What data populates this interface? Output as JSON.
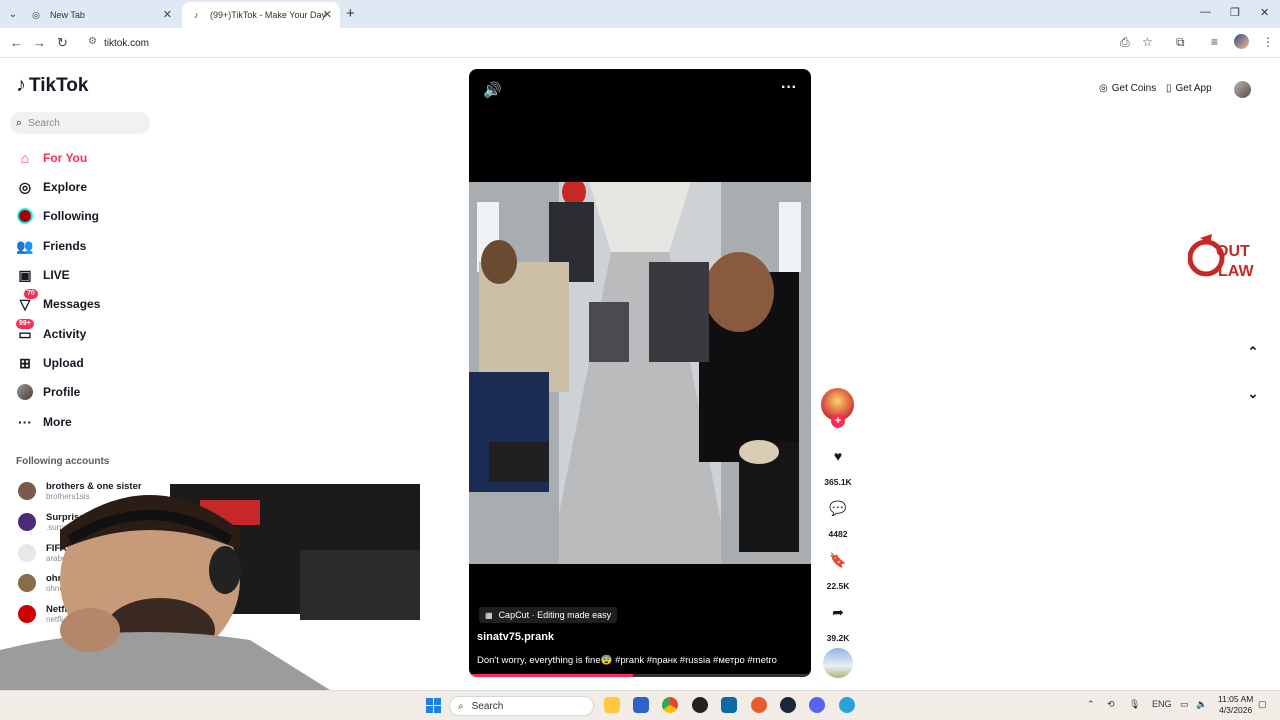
{
  "browser": {
    "tabs": [
      {
        "title": "New Tab",
        "active": false
      },
      {
        "title": "(99+)TikTok - Make Your Day",
        "active": true
      }
    ],
    "url": "tiktok.com"
  },
  "tiktok": {
    "logo_text": "TikTok",
    "search_placeholder": "Search",
    "menu": [
      {
        "label": "For You",
        "icon": "home-icon",
        "active": true
      },
      {
        "label": "Explore",
        "icon": "compass-icon"
      },
      {
        "label": "Following",
        "icon": "following-icon"
      },
      {
        "label": "Friends",
        "icon": "friends-icon"
      },
      {
        "label": "LIVE",
        "icon": "live-icon"
      },
      {
        "label": "Messages",
        "icon": "messages-icon",
        "badge": "70"
      },
      {
        "label": "Activity",
        "icon": "activity-icon",
        "badge": "99+"
      },
      {
        "label": "Upload",
        "icon": "upload-icon"
      },
      {
        "label": "Profile",
        "icon": "profile-icon"
      },
      {
        "label": "More",
        "icon": "more-icon"
      }
    ],
    "following_title": "Following accounts",
    "following_accounts": [
      {
        "name": "brothers & one sister",
        "handle": "brothers1sis"
      },
      {
        "name": "Surprise",
        "handle": ".surprise"
      },
      {
        "name": "FIFA Ara",
        "handle": "arabcupqa"
      },
      {
        "name": "ohnePix",
        "handle": "ohnepixel"
      },
      {
        "name": "NetflixM",
        "handle": "netfli"
      }
    ],
    "header": {
      "get_coins": "Get Coins",
      "get_app": "Get App"
    },
    "video": {
      "capcut_label": "CapCut · Editing made easy",
      "author": "sinatv75.prank",
      "caption": "Don't worry, everything is fine😨 #prank #пранк #russia #метро #metro",
      "progress": 0.48
    },
    "actions": {
      "likes": "365.1K",
      "comments": "4482",
      "saves": "22.5K",
      "shares": "39.2K"
    },
    "colors": {
      "accent": "#fe2c55",
      "text": "#161823"
    }
  },
  "taskbar": {
    "search_label": "Search",
    "lang": "ENG",
    "time": "11:05 AM",
    "date": "4/3/2026"
  }
}
